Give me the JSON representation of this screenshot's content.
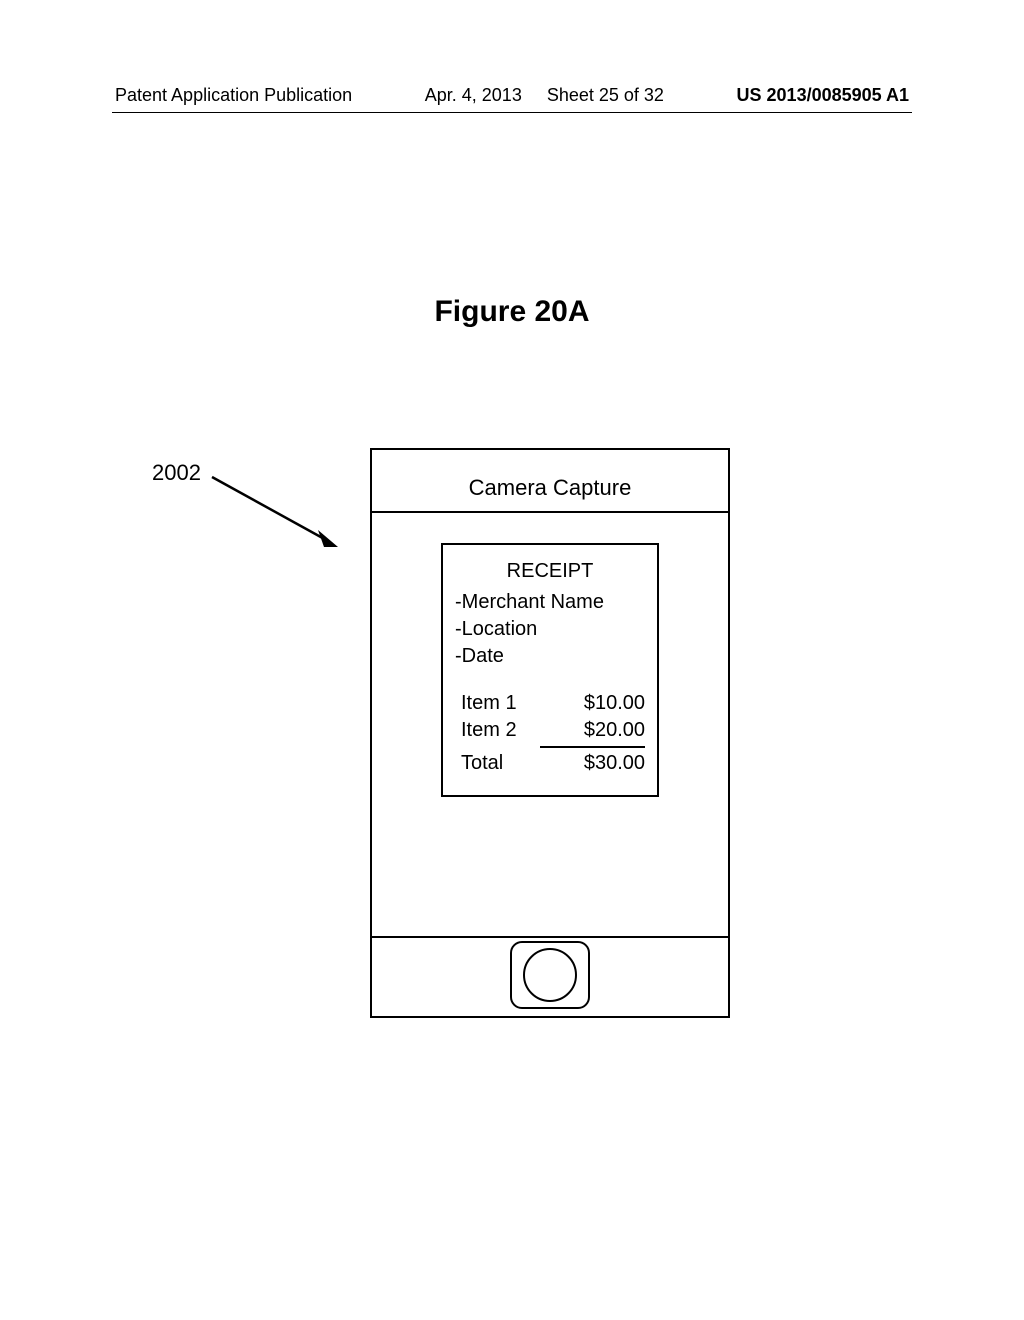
{
  "header": {
    "left": "Patent Application Publication",
    "date": "Apr. 4, 2013",
    "sheet": "Sheet 25 of 32",
    "pubnum": "US 2013/0085905 A1"
  },
  "figure": {
    "title": "Figure 20A",
    "ref_number": "2002"
  },
  "phone": {
    "title": "Camera Capture"
  },
  "receipt": {
    "heading": "RECEIPT",
    "fields": [
      "-Merchant Name",
      "-Location",
      "-Date"
    ],
    "items": [
      {
        "label": "Item 1",
        "price": "$10.00"
      },
      {
        "label": "Item 2",
        "price": "$20.00"
      }
    ],
    "total": {
      "label": "Total",
      "price": "$30.00"
    }
  }
}
